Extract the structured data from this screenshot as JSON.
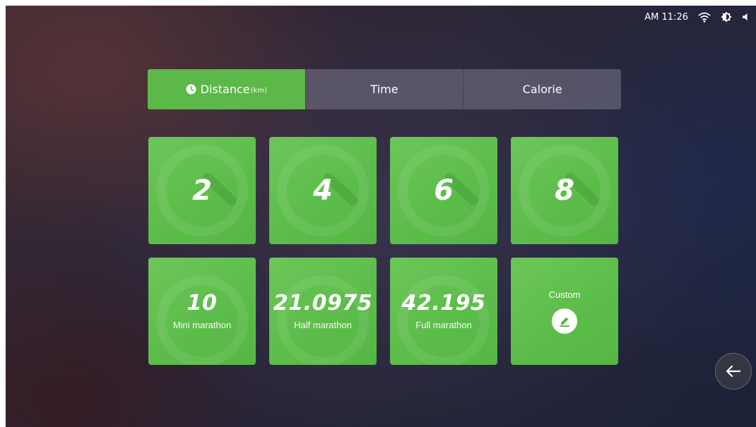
{
  "status_bar": {
    "time": "AM 11:26",
    "icons": [
      "wifi-icon",
      "brightness-icon",
      "volume-icon"
    ]
  },
  "tabs": [
    {
      "label": "Distance",
      "unit": "(km)",
      "icon": "clock-icon",
      "active": true
    },
    {
      "label": "Time",
      "active": false
    },
    {
      "label": "Calorie",
      "active": false
    }
  ],
  "tiles": [
    {
      "value": "2"
    },
    {
      "value": "4"
    },
    {
      "value": "6"
    },
    {
      "value": "8"
    },
    {
      "value": "10",
      "label": "Mini marathon"
    },
    {
      "value": "21.0975",
      "label": "Half marathon"
    },
    {
      "value": "42.195",
      "label": "Full marathon"
    },
    {
      "label": "Custom",
      "icon": "edit-icon"
    }
  ],
  "colors": {
    "accent": "#5cb848",
    "tab_inactive": "#6f6c80"
  },
  "back_button": {
    "icon": "back-arrow-icon"
  }
}
